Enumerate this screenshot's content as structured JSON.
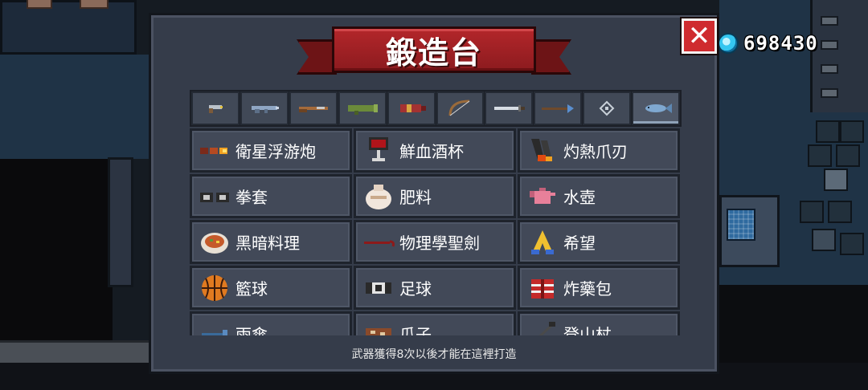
{
  "hud": {
    "gem_count": "698430"
  },
  "forge": {
    "title": "鍛造台",
    "close_glyph": "✕",
    "tabs": [
      {
        "icon": "pistol-icon",
        "active": false
      },
      {
        "icon": "rifle-icon",
        "active": false
      },
      {
        "icon": "shotgun-icon",
        "active": false
      },
      {
        "icon": "launcher-icon",
        "active": false
      },
      {
        "icon": "rocket-icon",
        "active": false
      },
      {
        "icon": "bow-icon",
        "active": false
      },
      {
        "icon": "sword-icon",
        "active": false
      },
      {
        "icon": "spear-icon",
        "active": false
      },
      {
        "icon": "staff-icon",
        "active": false
      },
      {
        "icon": "fish-icon",
        "active": true
      }
    ],
    "items": [
      {
        "name": "衛星浮游炮",
        "icon": "satellite-cannon-icon"
      },
      {
        "name": "鮮血酒杯",
        "icon": "blood-goblet-icon"
      },
      {
        "name": "灼熱爪刃",
        "icon": "scorching-claw-icon"
      },
      {
        "name": "拳套",
        "icon": "gauntlet-icon"
      },
      {
        "name": "肥料",
        "icon": "fertilizer-bag-icon"
      },
      {
        "name": "水壺",
        "icon": "kettle-icon"
      },
      {
        "name": "黑暗料理",
        "icon": "dark-cuisine-icon"
      },
      {
        "name": "物理學聖劍",
        "icon": "crowbar-icon"
      },
      {
        "name": "希望",
        "icon": "hope-icon"
      },
      {
        "name": "籃球",
        "icon": "basketball-icon"
      },
      {
        "name": "足球",
        "icon": "soccer-ball-icon"
      },
      {
        "name": "炸藥包",
        "icon": "dynamite-pack-icon"
      },
      {
        "name": "雨傘",
        "icon": "umbrella-icon"
      },
      {
        "name": "瓜子",
        "icon": "melon-seeds-icon"
      },
      {
        "name": "登山杖",
        "icon": "hiking-pole-icon"
      }
    ],
    "footer_note": "武器獲得8次以後才能在這裡打造"
  },
  "colors": {
    "panel_bg": "#353c4a",
    "banner_red": "#b3262a",
    "close_red": "#cf2b2f",
    "gem_blue": "#35c6f0"
  }
}
